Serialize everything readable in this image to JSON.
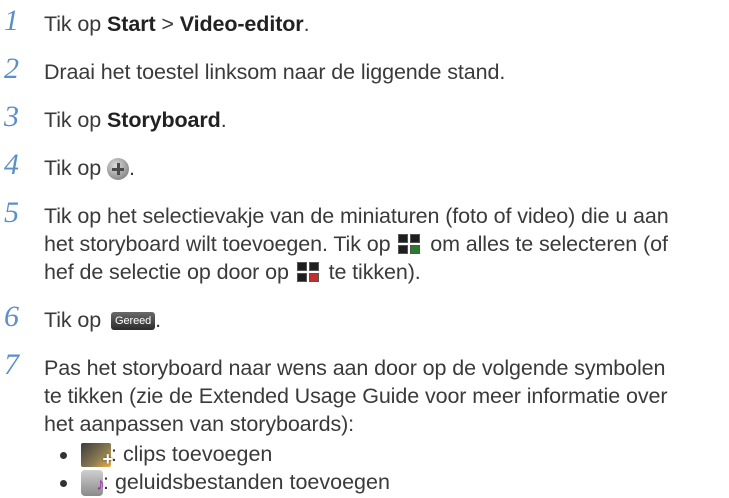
{
  "steps": [
    {
      "num": "1",
      "parts": [
        "Tik op ",
        "Start",
        " > ",
        "Video-editor",
        "."
      ]
    },
    {
      "num": "2",
      "text": "Draai het toestel linksom naar de liggende stand."
    },
    {
      "num": "3",
      "parts": [
        "Tik op ",
        "Storyboard",
        "."
      ]
    },
    {
      "num": "4",
      "pre": "Tik op ",
      "post": "."
    },
    {
      "num": "5",
      "line1": "Tik op het selectievakje van de miniaturen (foto of video) die u aan",
      "line2a": "het storyboard wilt toevoegen. Tik op ",
      "line2b": " om alles te selecteren (of",
      "line3a": "hef de selectie op door op ",
      "line3b": " te tikken)."
    },
    {
      "num": "6",
      "pre": "Tik op ",
      "button": "Gereed",
      "post": "."
    },
    {
      "num": "7",
      "line1": "Pas het storyboard naar wens aan door op de volgende symbolen",
      "line2": "te tikken (zie de Extended Usage Guide voor meer informatie over",
      "line3": "het aanpassen van storyboards):"
    }
  ],
  "bullets": [
    {
      "icon": "clip-add-icon",
      "text": ": clips toevoegen"
    },
    {
      "icon": "audio-add-icon",
      "text": ": geluidsbestanden toevoegen"
    }
  ]
}
